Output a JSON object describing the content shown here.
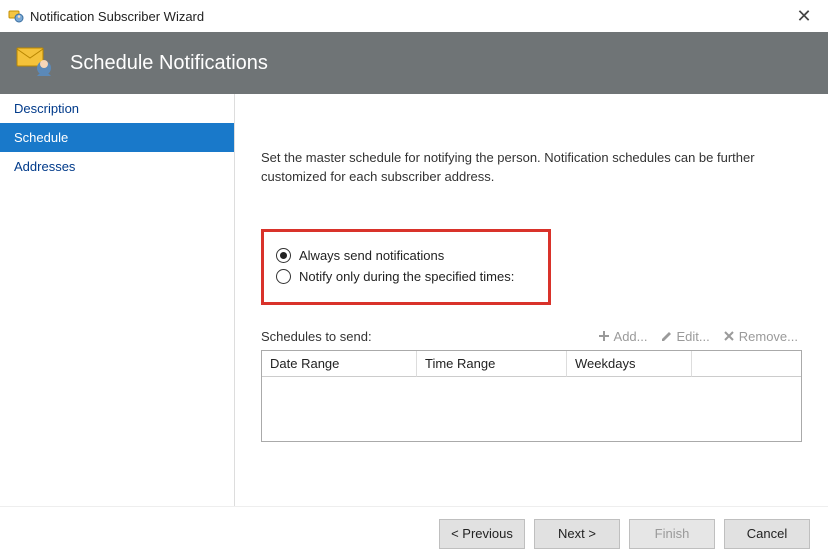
{
  "window": {
    "title": "Notification Subscriber Wizard",
    "close": "✕"
  },
  "header": {
    "title": "Schedule Notifications"
  },
  "sidebar": {
    "items": [
      {
        "label": "Description"
      },
      {
        "label": "Schedule"
      },
      {
        "label": "Addresses"
      }
    ]
  },
  "content": {
    "description": "Set the master schedule for notifying the person. Notification schedules can be further customized for each subscriber address.",
    "radios": {
      "always": "Always send notifications",
      "specified": "Notify only during the specified times:"
    },
    "schedules_label": "Schedules to send:",
    "toolbar": {
      "add": "Add...",
      "edit": "Edit...",
      "remove": "Remove..."
    },
    "table": {
      "headers": {
        "date_range": "Date Range",
        "time_range": "Time Range",
        "weekdays": "Weekdays"
      }
    }
  },
  "footer": {
    "previous": "< Previous",
    "next": "Next >",
    "finish": "Finish",
    "cancel": "Cancel"
  }
}
